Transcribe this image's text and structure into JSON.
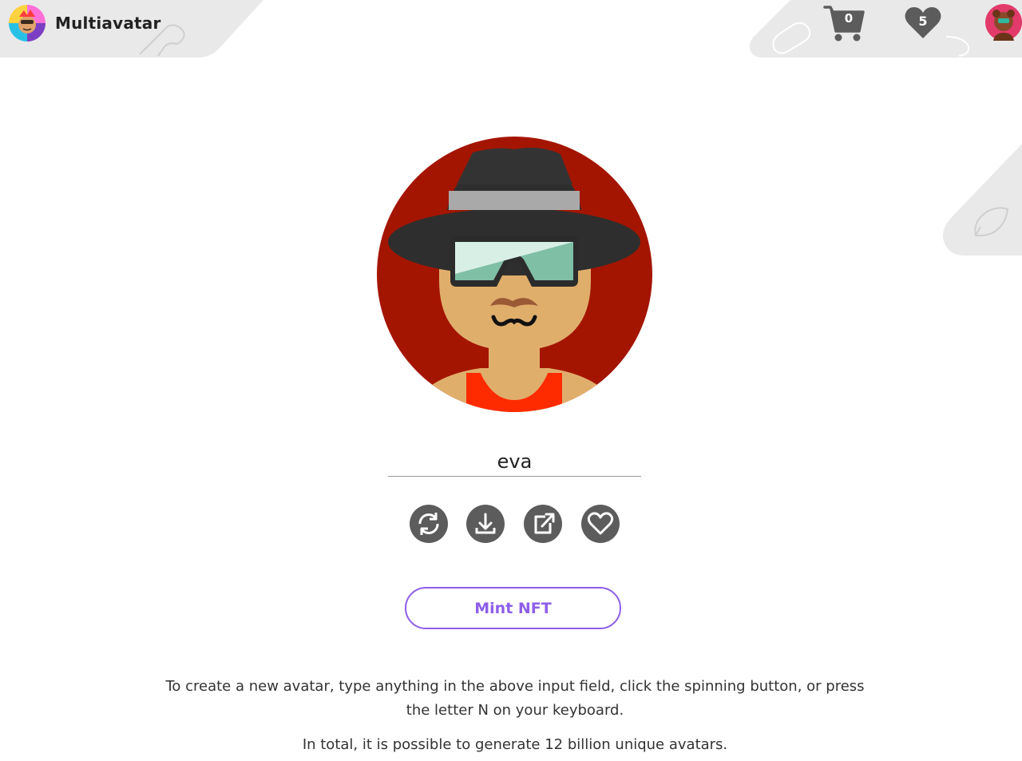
{
  "header": {
    "brand": "Multiavatar",
    "cart_count": "0",
    "favorites_count": "5"
  },
  "generator": {
    "input_value": "eva",
    "actions": [
      {
        "name": "refresh-icon",
        "label": "New avatar"
      },
      {
        "name": "download-icon",
        "label": "Download"
      },
      {
        "name": "external-link-icon",
        "label": "Open"
      },
      {
        "name": "heart-icon",
        "label": "Favorite"
      }
    ],
    "mint_label": "Mint NFT"
  },
  "info": {
    "line1": "To create a new avatar, type anything in the above input field, click the spinning button, or press the letter N on your keyboard.",
    "line2": "In total, it is possible to generate 12 billion unique avatars."
  },
  "colors": {
    "accent": "#8e5ee8",
    "icon_gray": "#5c5c5c",
    "header_gray": "#e9e9e9",
    "avatar_bg": "#a41500"
  }
}
